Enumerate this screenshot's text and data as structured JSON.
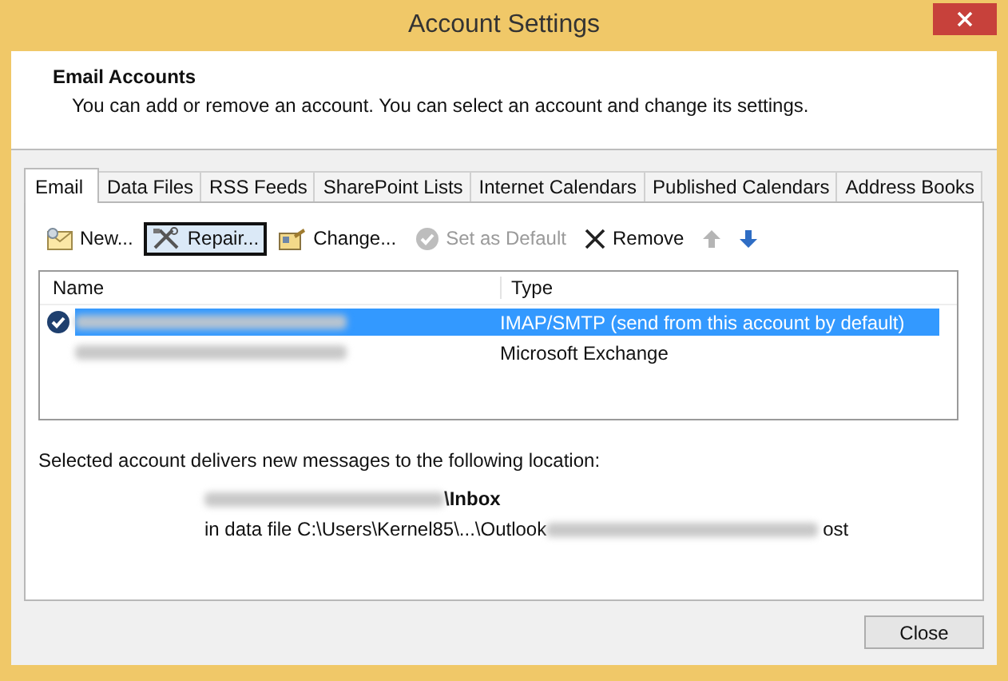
{
  "window": {
    "title": "Account Settings"
  },
  "header": {
    "title": "Email Accounts",
    "description": "You can add or remove an account. You can select an account and change its settings."
  },
  "tabs": [
    {
      "label": "Email",
      "selected": true
    },
    {
      "label": "Data Files",
      "selected": false
    },
    {
      "label": "RSS Feeds",
      "selected": false
    },
    {
      "label": "SharePoint Lists",
      "selected": false
    },
    {
      "label": "Internet Calendars",
      "selected": false
    },
    {
      "label": "Published Calendars",
      "selected": false
    },
    {
      "label": "Address Books",
      "selected": false
    }
  ],
  "toolbar": [
    {
      "kind": "new",
      "label": "New...",
      "disabled": false,
      "focused": false
    },
    {
      "kind": "repair",
      "label": "Repair...",
      "disabled": false,
      "focused": true
    },
    {
      "kind": "change",
      "label": "Change...",
      "disabled": false,
      "focused": false
    },
    {
      "kind": "default",
      "label": "Set as Default",
      "disabled": true,
      "focused": false
    },
    {
      "kind": "remove",
      "label": "Remove",
      "disabled": false,
      "focused": false
    },
    {
      "kind": "up",
      "disabled": true,
      "focused": false
    },
    {
      "kind": "down",
      "disabled": false,
      "focused": false
    }
  ],
  "accounts": {
    "columns": [
      "Name",
      "Type"
    ],
    "rows": [
      {
        "type": "IMAP/SMTP (send from this account by default)",
        "selected": true,
        "default": true
      },
      {
        "type": "Microsoft Exchange",
        "selected": false,
        "default": false
      }
    ]
  },
  "delivery": {
    "label": "Selected account delivers new messages to the following location:",
    "folder": "\\Inbox",
    "data_file": "in data file C:\\Users\\Kernel85\\...\\Outlook",
    "data_file_end": "ost"
  },
  "buttons": [
    {
      "label": "Close"
    }
  ]
}
